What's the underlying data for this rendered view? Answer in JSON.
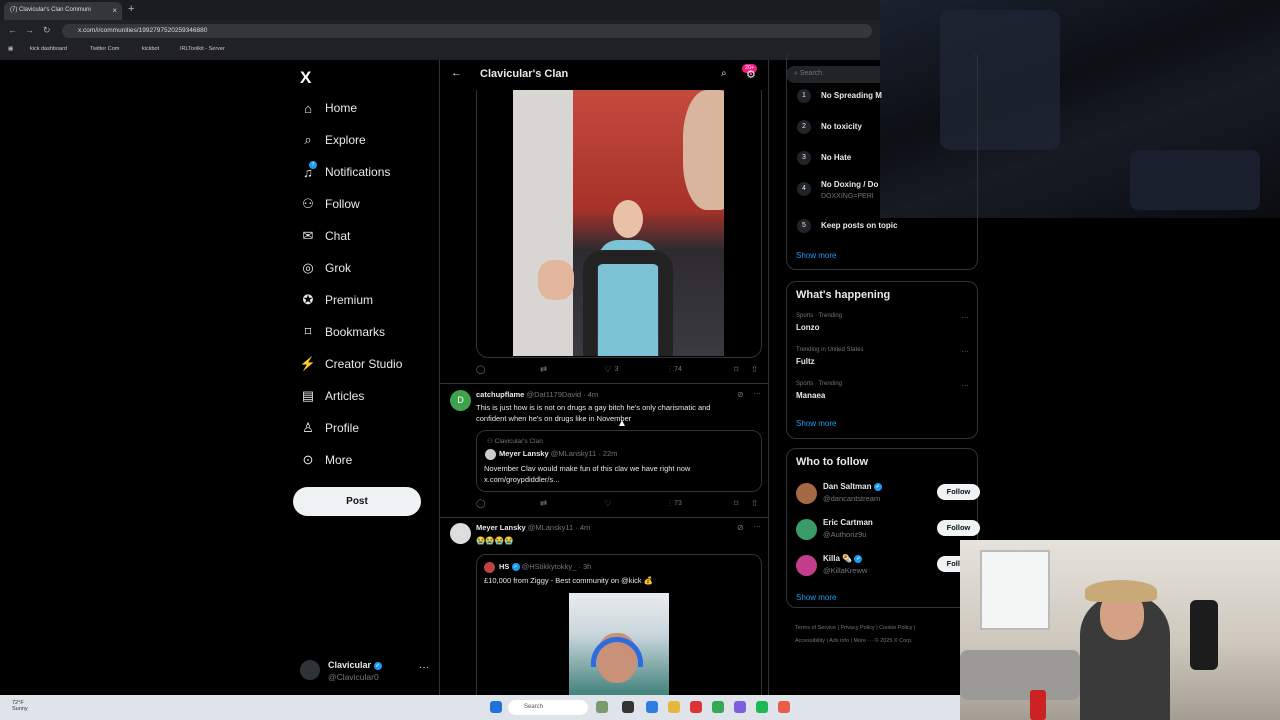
{
  "browser": {
    "tab_title": "(7) Clavicular's Clan Communi",
    "tab_close": "×",
    "new_tab": "+",
    "url": "x.com/i/communities/1992797520259346880",
    "bookmarks": [
      "kick dashboard",
      "Twitter Com",
      "kickbot",
      "IRLToolkit - Server"
    ]
  },
  "sidebar": {
    "logo": "X",
    "items": [
      {
        "label": "Home",
        "icon": "home-icon"
      },
      {
        "label": "Explore",
        "icon": "search-icon"
      },
      {
        "label": "Notifications",
        "icon": "bell-icon"
      },
      {
        "label": "Follow",
        "icon": "follow-icon"
      },
      {
        "label": "Chat",
        "icon": "mail-icon"
      },
      {
        "label": "Grok",
        "icon": "grok-icon"
      },
      {
        "label": "Premium",
        "icon": "premium-icon"
      },
      {
        "label": "Bookmarks",
        "icon": "bookmark-icon"
      },
      {
        "label": "Creator Studio",
        "icon": "creator-icon"
      },
      {
        "label": "Articles",
        "icon": "articles-icon"
      },
      {
        "label": "Profile",
        "icon": "person-icon"
      },
      {
        "label": "More",
        "icon": "more-icon"
      }
    ],
    "post_label": "Post",
    "profile": {
      "name": "Clavicular",
      "handle": "@Clavicular0",
      "more": "···"
    }
  },
  "feed": {
    "title": "Clavicular's Clan",
    "badge": "20+",
    "tweet1_actions": {
      "likes": "3",
      "views": "74"
    },
    "tweet2": {
      "avatar_letter": "D",
      "name": "catchupflame",
      "handle": "@Dat1179David",
      "time": "· 4m",
      "text_line1": "This is just how is is not on drugs a gay bitch he's only charismatic and",
      "text_line2": "confident when he's on drugs like in November",
      "quote": {
        "community": "Clavicular's Clan",
        "name": "Meyer Lansky",
        "handle": "@MLansky11",
        "time": "· 22m",
        "text_line1": "November Clav would make fun of this clav we have right now",
        "text_line2": "x.com/groypdiddler/s..."
      },
      "views": "73"
    },
    "tweet3": {
      "name": "Meyer Lansky",
      "handle": "@MLansky11",
      "time": "· 4m",
      "text": "😭😭😭😭",
      "quote": {
        "name": "HS",
        "handle": "@HStikkytokky_",
        "time": "· 3h",
        "text": "£10,000 from Ziggy - Best community on @kick 💰"
      }
    }
  },
  "right": {
    "search_placeholder": "Search",
    "rules": [
      {
        "num": "1",
        "title": "No Spreading M",
        "sub": ""
      },
      {
        "num": "2",
        "title": "No toxicity",
        "sub": ""
      },
      {
        "num": "3",
        "title": "No Hate",
        "sub": ""
      },
      {
        "num": "4",
        "title": "No Doxing / Do",
        "sub": "DOXXING=PERI"
      },
      {
        "num": "5",
        "title": "Keep posts on topic",
        "sub": ""
      }
    ],
    "show_more": "Show more",
    "happening_title": "What's happening",
    "trends": [
      {
        "meta": "Sports · Trending",
        "name": "Lonzo"
      },
      {
        "meta": "Trending in United States",
        "name": "Fultz"
      },
      {
        "meta": "Sports · Trending",
        "name": "Manaea"
      }
    ],
    "wtf_title": "Who to follow",
    "follow_label": "Follow",
    "who_to_follow": [
      {
        "name": "Dan Saltman",
        "handle": "@dancantstream"
      },
      {
        "name": "Eric Cartman",
        "handle": "@Authoriz9u"
      },
      {
        "name": "Killa 🌯",
        "handle": "@KillaKreww"
      }
    ],
    "footer_line1": "Terms of Service  |  Privacy Policy  |  Cookie Policy  |",
    "footer_line2": "Accessibility  |  Ads info  |  More ···  © 2025 X Corp."
  },
  "taskbar": {
    "temp": "72°F",
    "condition": "Sunny",
    "search": "Search"
  },
  "colors": {
    "accent": "#1d9bf0",
    "background": "#000000",
    "border": "#2f3336",
    "muted": "#71767b"
  }
}
